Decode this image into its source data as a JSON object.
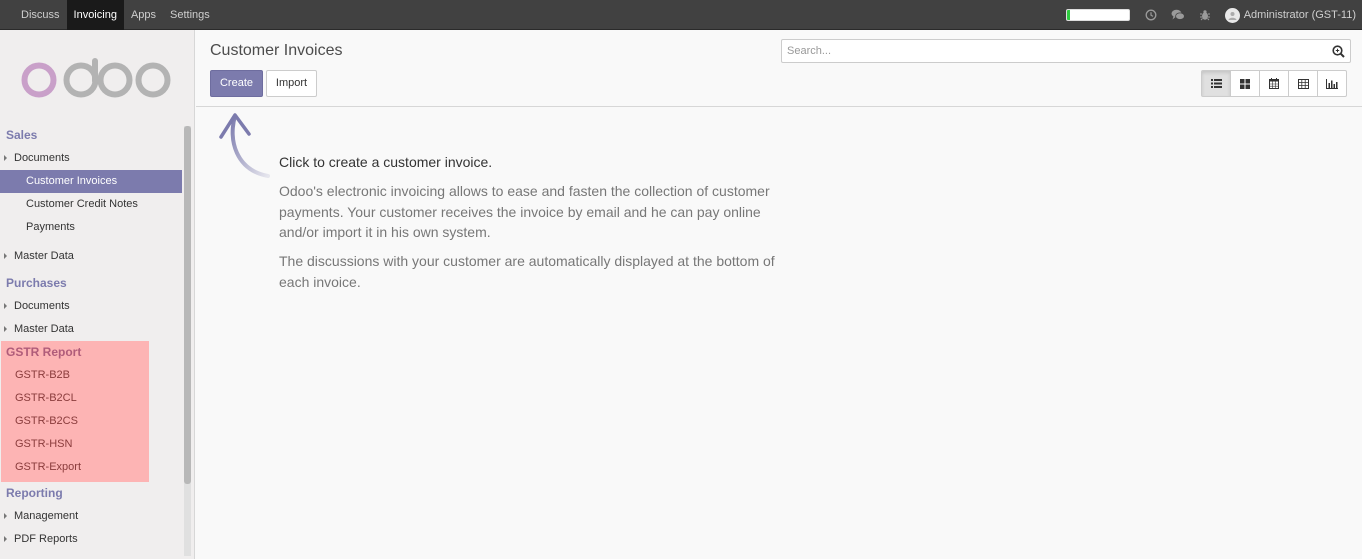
{
  "topbar": {
    "menu": [
      "Discuss",
      "Invoicing",
      "Apps",
      "Settings"
    ],
    "active_index": 1,
    "progress_fraction": 0.06,
    "icons": [
      "clock-icon",
      "chat-icon",
      "bug-icon"
    ],
    "user": "Administrator (GST-11)"
  },
  "sidebar": {
    "logo_text": "odoo",
    "sales": {
      "title": "Sales",
      "documents": "Documents",
      "customer_invoices": "Customer Invoices",
      "customer_credit_notes": "Customer Credit Notes",
      "payments": "Payments",
      "master_data": "Master Data"
    },
    "purchases": {
      "title": "Purchases",
      "documents": "Documents",
      "master_data": "Master Data"
    },
    "gstr": {
      "title": "GSTR Report",
      "items": [
        "GSTR-B2B",
        "GSTR-B2CL",
        "GSTR-B2CS",
        "GSTR-HSN",
        "GSTR-Export"
      ]
    },
    "reporting": {
      "title": "Reporting",
      "management": "Management",
      "pdf_reports": "PDF Reports"
    }
  },
  "control_panel": {
    "breadcrumb": "Customer Invoices",
    "create_label": "Create",
    "import_label": "Import",
    "search_placeholder": "Search...",
    "views": [
      "list-view-icon",
      "kanban-view-icon",
      "calendar-view-icon",
      "pivot-view-icon",
      "graph-view-icon"
    ],
    "active_view": "list-view-icon"
  },
  "help": {
    "title": "Click to create a customer invoice.",
    "p1": "Odoo's electronic invoicing allows to ease and fasten the collection of customer payments. Your customer receives the invoice by email and he can pay online and/or import it in his own system.",
    "p2": "The discussions with your customer are automatically displayed at the bottom of each invoice."
  },
  "colors": {
    "accent": "#7c7bad",
    "topbar": "#414141",
    "gstr_highlight": "#fdb4b4",
    "progress": "#2ecc40"
  }
}
